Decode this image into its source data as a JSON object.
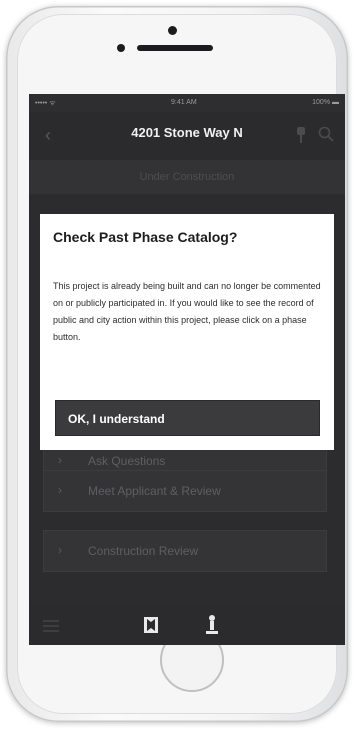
{
  "status_bar": {
    "carrier": "••••• ᯤ",
    "time": "9:41 AM",
    "battery": "100% ▬"
  },
  "nav": {
    "title": "4201 Stone Way N"
  },
  "subheader": {
    "text": "Under Construction"
  },
  "phases": [
    {
      "label": "Ask Questions"
    },
    {
      "label": "Meet Applicant & Review"
    },
    {
      "label": "Construction Review"
    }
  ],
  "dialog": {
    "title": "Check Past Phase Catalog?",
    "body": "This project is already being built and can no longer be commented on or publicly participated in. If you would like to see the record of public and city action within this project, please click on a phase button.",
    "button_label": "OK, I understand"
  },
  "icons": [
    "back-icon",
    "pin-icon",
    "search-icon",
    "menu-icon",
    "map-icon",
    "person-icon"
  ]
}
